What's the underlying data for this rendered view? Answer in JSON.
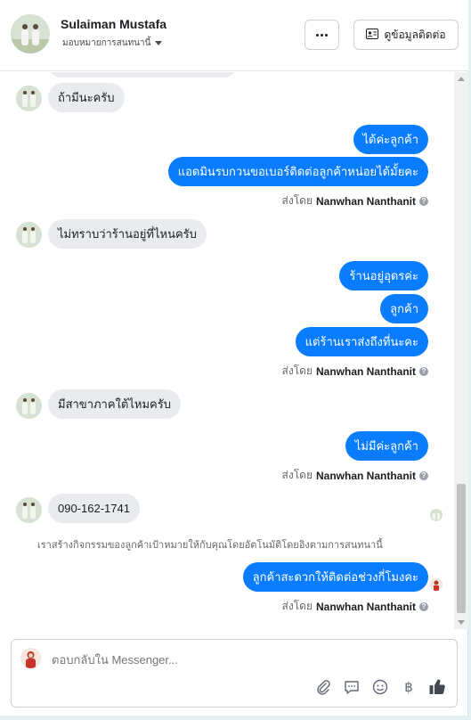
{
  "header": {
    "name": "Sulaiman Mustafa",
    "assign_label": "มอบหมายการสนทนานี้",
    "more_label": "···",
    "contact_label": "ดูข้อมูลติดต่อ"
  },
  "messages": {
    "in_1": "ถ้ามีนะครับ",
    "out_1a": "ได้ค่ะลูกค้า",
    "out_1b": "แอดมินรบกวนขอเบอร์ติดต่อลูกค้าหน่อยได้มั้ยคะ",
    "in_2": "ไม่ทราบว่าร้านอยู่ที่ไหนครับ",
    "out_2a": "ร้านอยู่อุดรค่ะ",
    "out_2b": "ลูกค้า",
    "out_2c": "แต่ร้านเราส่งถึงที่นะคะ",
    "in_3": "มีสาขาภาคใต้ไหมครับ",
    "out_3a": "ไม่มีค่ะลูกค้า",
    "in_4": "090-162-1741",
    "system_note": "เราสร้างกิจกรรมของลูกค้าเป้าหมายให้กับคุณโดยอัตโนมัติโดยอิงตามการสนทนานี้",
    "out_4a": "ลูกค้าสะดวกให้ติดต่อช่วงกี่โมงคะ"
  },
  "sent_by": {
    "prefix": "ส่งโดย",
    "agent": "Nanwhan Nanthanit",
    "help": "?"
  },
  "composer": {
    "placeholder": "ตอบกลับใน Messenger..."
  },
  "icons": {
    "attach": "paperclip-icon",
    "saved_replies": "chat-bubble-icon",
    "emoji": "smiley-icon",
    "payment": "baht-icon",
    "like": "thumbs-up-icon"
  },
  "colors": {
    "outgoing_bubble": "#0a7cff",
    "incoming_bubble": "#e9ebee",
    "background": "#e4f1f2"
  }
}
